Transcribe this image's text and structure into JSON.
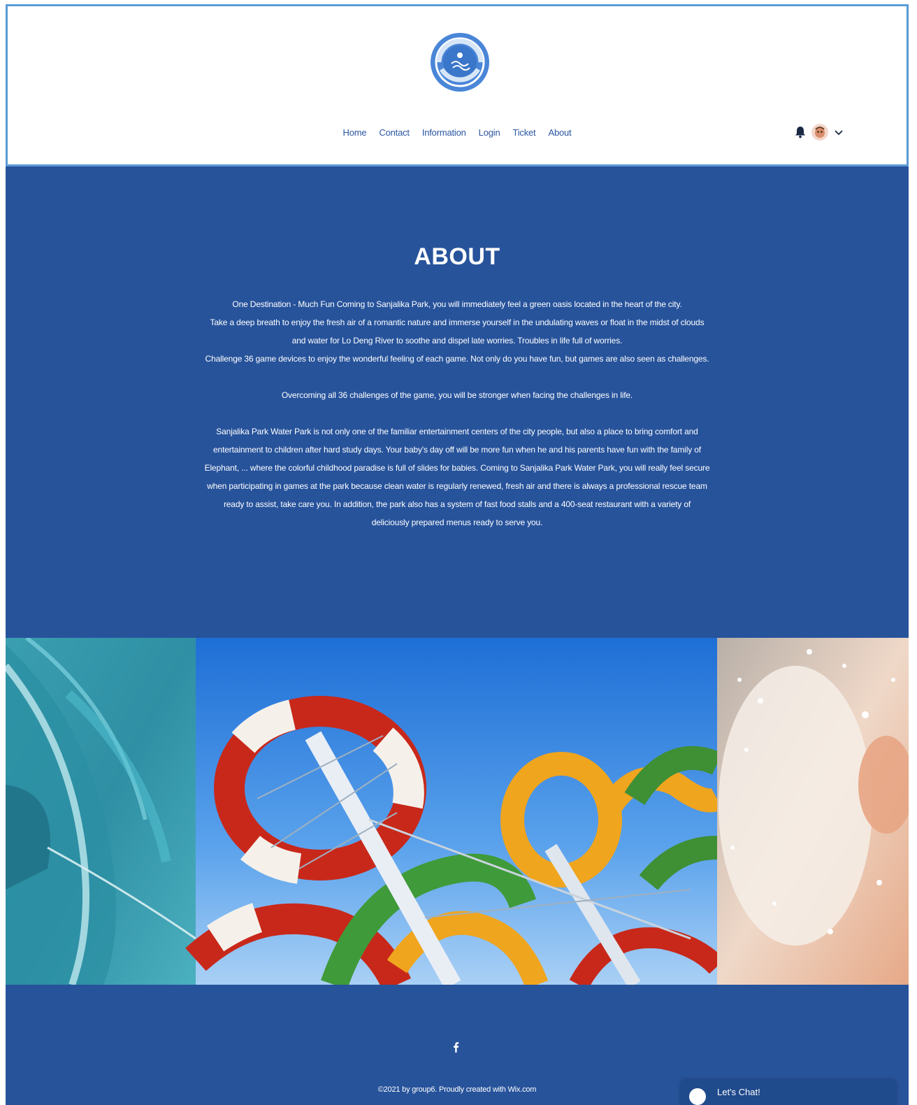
{
  "header": {
    "logo_name": "water-park-badge-logo",
    "nav": [
      "Home",
      "Contact",
      "Information",
      "Login",
      "Ticket",
      "About"
    ],
    "icons": [
      "bell-icon",
      "avatar",
      "chevron-down-icon"
    ]
  },
  "about": {
    "title": "ABOUT",
    "paragraphs": [
      "One Destination - Much Fun Coming to Sanjalika Park, you will immediately feel a green oasis located in the heart of the city.",
      "Take a deep breath to enjoy the fresh air of a romantic nature and immerse yourself in the undulating waves or float in the midst of clouds and water for Lo Deng River to soothe and dispel late worries. Troubles in life full of worries.",
      "Challenge 36 game devices to enjoy the wonderful feeling of each game. Not only do you have fun, but games are also seen as challenges.",
      "Overcoming all 36 challenges of the game, you will be stronger when facing the challenges in life.",
      "Sanjalika Park Water Park is not only one of the familiar entertainment centers of the city people, but also a place to bring comfort and entertainment to children after hard study days. Your baby's day off will be more fun when he and his parents have fun with the family of Elephant, ... where the colorful childhood paradise is full of slides for babies. Coming to Sanjalika Park Water Park, you will really feel secure when participating in games at the park because clean water is regularly renewed, fresh air and there is always a professional rescue team ready to assist, take care you. In addition, the park also has a system of fast food stalls and a 400-seat restaurant with a variety of deliciously prepared menus ready to serve you."
    ]
  },
  "gallery": {
    "images": [
      "water-slide-tube-photo",
      "colorful-water-slides-photo",
      "water-splash-photo"
    ]
  },
  "footer": {
    "social_icon": "facebook-icon",
    "copyright": "©2021 by group6. Proudly created with Wix.com",
    "chat_label": "Let's Chat!"
  },
  "colors": {
    "brand_blue": "#27539b",
    "header_border": "#5b9bd5",
    "nav_text": "#2b56a2"
  }
}
